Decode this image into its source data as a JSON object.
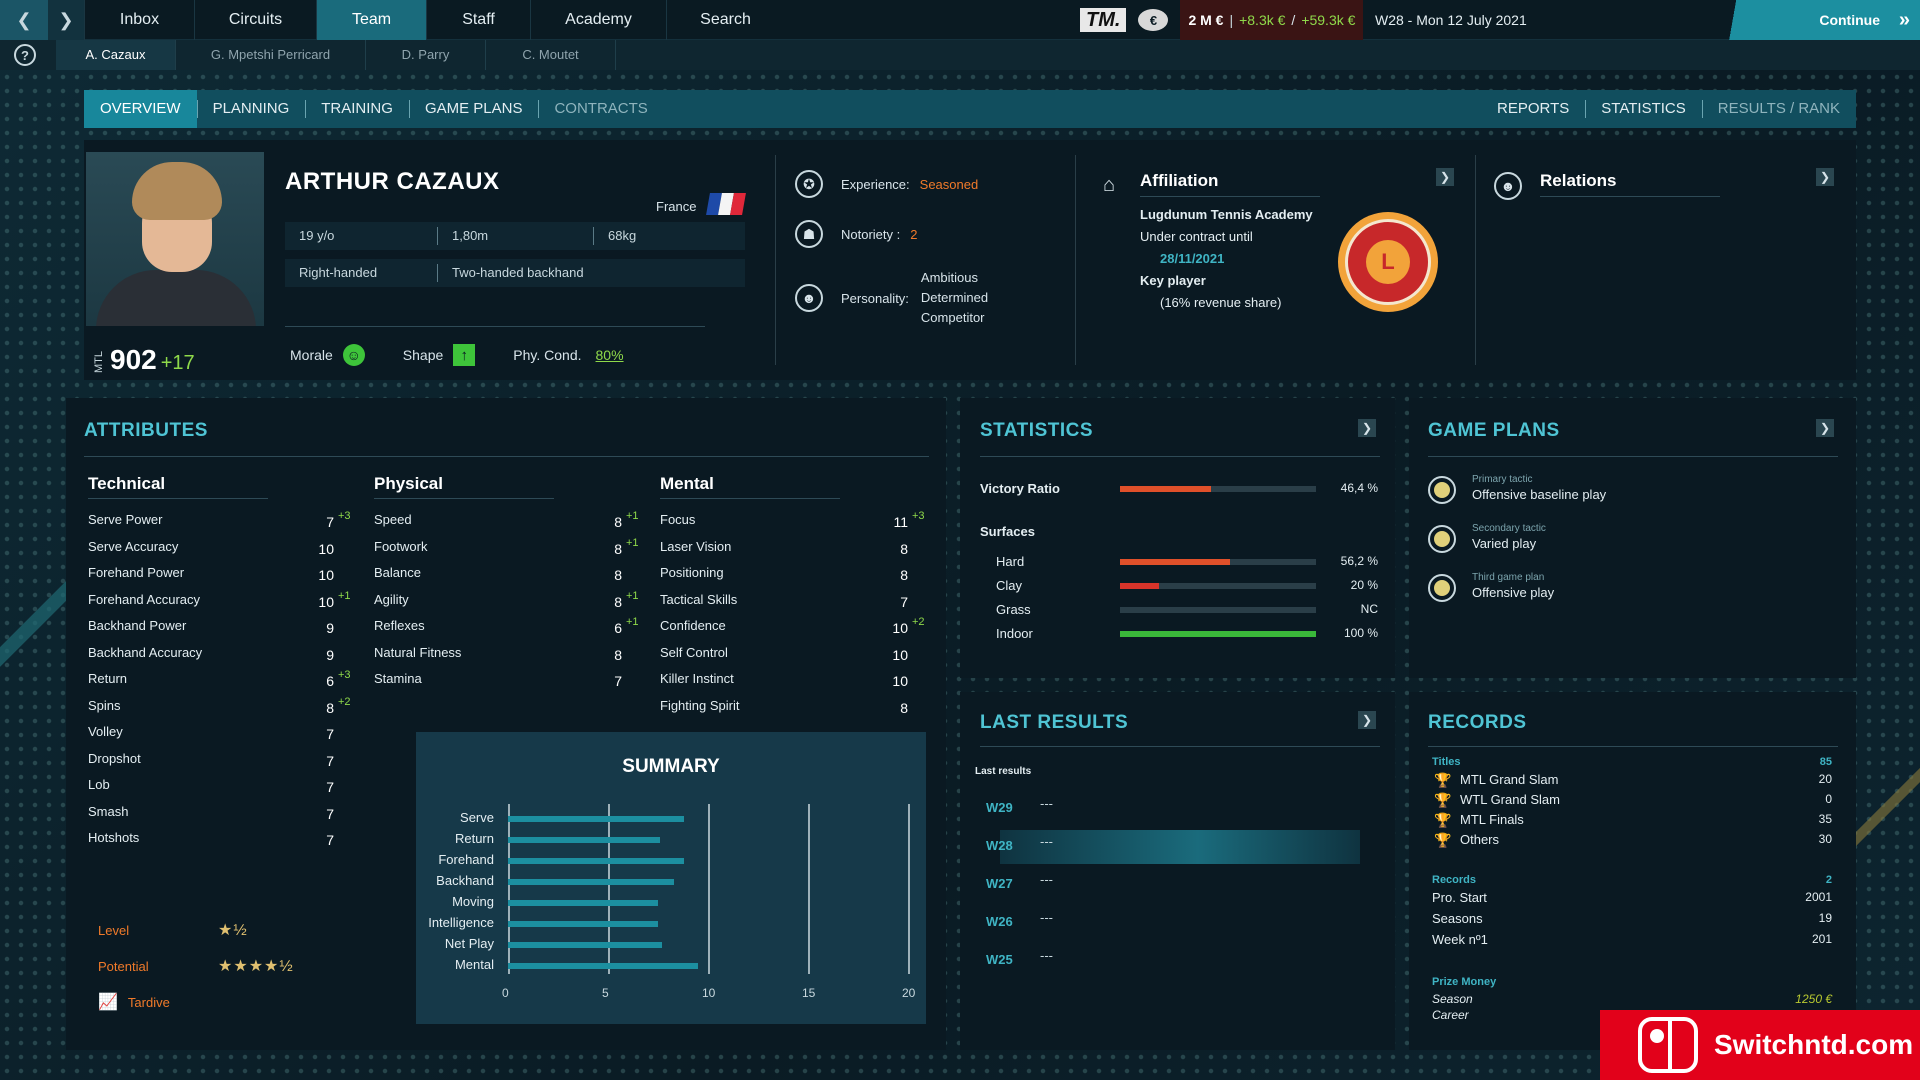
{
  "colors": {
    "accent": "#1a6b7c",
    "positive": "#8fd94a",
    "negative": "#f04a3a",
    "highlight_orange": "#f07a2a",
    "title_cyan": "#4fc4d4"
  },
  "topbar": {
    "nav": [
      "Inbox",
      "Circuits",
      "Team",
      "Staff",
      "Academy",
      "Search"
    ],
    "active_nav": "Team",
    "logo": "TM.",
    "balance": "2 M €",
    "income": "+8.3k €",
    "separator": "/",
    "extra_income": "+59.3k €",
    "date": "W28 - Mon 12 July 2021",
    "continue_label": "Continue"
  },
  "players": [
    "A. Cazaux",
    "G. Mpetshi Perricard",
    "D. Parry",
    "C. Moutet"
  ],
  "tabs_left": [
    "OVERVIEW",
    "PLANNING",
    "TRAINING",
    "GAME PLANS",
    "CONTRACTS"
  ],
  "tabs_right": [
    "REPORTS",
    "STATISTICS",
    "RESULTS / RANK"
  ],
  "player": {
    "name": "ARTHUR CAZAUX",
    "country": "France",
    "age": "19 y/o",
    "height": "1,80m",
    "weight": "68kg",
    "hand": "Right-handed",
    "backhand": "Two-handed backhand",
    "mtl_label": "MTL",
    "mtl": "902",
    "mtl_delta": "+17",
    "morale_label": "Morale",
    "shape_label": "Shape",
    "phy_label": "Phy. Cond.",
    "phy_value": "80%"
  },
  "traits": {
    "experience_label": "Experience:",
    "experience_value": "Seasoned",
    "notoriety_label": "Notoriety :",
    "notoriety_value": "2",
    "personality_label": "Personality:",
    "personality": [
      "Ambitious",
      "Determined",
      "Competitor"
    ]
  },
  "affiliation": {
    "title": "Affiliation",
    "academy": "Lugdunum Tennis Academy",
    "contract_label": "Under contract until",
    "contract_date": "28/11/2021",
    "role": "Key player",
    "share": "(16% revenue share)",
    "logo_text": "L"
  },
  "relations": {
    "title": "Relations"
  },
  "attributes": {
    "title": "ATTRIBUTES",
    "technical_title": "Technical",
    "physical_title": "Physical",
    "mental_title": "Mental",
    "technical": [
      {
        "name": "Serve Power",
        "value": "7",
        "bonus": "+3"
      },
      {
        "name": "Serve Accuracy",
        "value": "10",
        "bonus": ""
      },
      {
        "name": "Forehand Power",
        "value": "10",
        "bonus": ""
      },
      {
        "name": "Forehand Accuracy",
        "value": "10",
        "bonus": "+1"
      },
      {
        "name": "Backhand Power",
        "value": "9",
        "bonus": ""
      },
      {
        "name": "Backhand Accuracy",
        "value": "9",
        "bonus": ""
      },
      {
        "name": "Return",
        "value": "6",
        "bonus": "+3"
      },
      {
        "name": "Spins",
        "value": "8",
        "bonus": "+2"
      },
      {
        "name": "Volley",
        "value": "7",
        "bonus": ""
      },
      {
        "name": "Dropshot",
        "value": "7",
        "bonus": ""
      },
      {
        "name": "Lob",
        "value": "7",
        "bonus": ""
      },
      {
        "name": "Smash",
        "value": "7",
        "bonus": ""
      },
      {
        "name": "Hotshots",
        "value": "7",
        "bonus": ""
      }
    ],
    "physical": [
      {
        "name": "Speed",
        "value": "8",
        "bonus": "+1"
      },
      {
        "name": "Footwork",
        "value": "8",
        "bonus": "+1"
      },
      {
        "name": "Balance",
        "value": "8",
        "bonus": ""
      },
      {
        "name": "Agility",
        "value": "8",
        "bonus": "+1"
      },
      {
        "name": "Reflexes",
        "value": "6",
        "bonus": "+1"
      },
      {
        "name": "Natural Fitness",
        "value": "8",
        "bonus": ""
      },
      {
        "name": "Stamina",
        "value": "7",
        "bonus": ""
      }
    ],
    "mental": [
      {
        "name": "Focus",
        "value": "11",
        "bonus": "+3"
      },
      {
        "name": "Laser Vision",
        "value": "8",
        "bonus": ""
      },
      {
        "name": "Positioning",
        "value": "8",
        "bonus": ""
      },
      {
        "name": "Tactical Skills",
        "value": "7",
        "bonus": ""
      },
      {
        "name": "Confidence",
        "value": "10",
        "bonus": "+2"
      },
      {
        "name": "Self Control",
        "value": "10",
        "bonus": ""
      },
      {
        "name": "Killer Instinct",
        "value": "10",
        "bonus": ""
      },
      {
        "name": "Fighting Spirit",
        "value": "8",
        "bonus": ""
      }
    ],
    "level_label": "Level",
    "level_stars": "★½",
    "potential_label": "Potential",
    "potential_stars": "★★★★½",
    "tardive_label": "Tardive"
  },
  "summary": {
    "title": "SUMMARY",
    "ticks": [
      "0",
      "5",
      "10",
      "15",
      "20"
    ]
  },
  "chart_data": {
    "type": "bar",
    "categories": [
      "Serve",
      "Return",
      "Forehand",
      "Backhand",
      "Moving",
      "Intelligence",
      "Net Play",
      "Mental"
    ],
    "values": [
      8.8,
      7.6,
      8.8,
      8.3,
      7.5,
      7.5,
      7.7,
      9.5
    ],
    "title": "SUMMARY",
    "xlim": [
      0,
      20
    ]
  },
  "statistics": {
    "title": "STATISTICS",
    "victory_label": "Victory Ratio",
    "victory_value": "46,4 %",
    "victory_ratio": 0.464,
    "surfaces_label": "Surfaces",
    "surfaces": [
      {
        "name": "Hard",
        "value": "56,2 %",
        "ratio": 0.562,
        "color": "#e0502a"
      },
      {
        "name": "Clay",
        "value": "20 %",
        "ratio": 0.2,
        "color": "#d8342a"
      },
      {
        "name": "Grass",
        "value": "NC",
        "ratio": 0,
        "color": "#2a3e48"
      },
      {
        "name": "Indoor",
        "value": "100 %",
        "ratio": 1.0,
        "color": "#3ab83a"
      }
    ]
  },
  "game_plans": {
    "title": "GAME PLANS",
    "items": [
      {
        "small": "Primary tactic",
        "main": "Offensive baseline play"
      },
      {
        "small": "Secondary tactic",
        "main": "Varied play"
      },
      {
        "small": "Third game plan",
        "main": "Offensive play"
      }
    ]
  },
  "last_results": {
    "title": "LAST RESULTS",
    "subtitle": "Last results",
    "weeks": [
      {
        "week": "W29",
        "result": "---"
      },
      {
        "week": "W28",
        "result": "---"
      },
      {
        "week": "W27",
        "result": "---"
      },
      {
        "week": "W26",
        "result": "---"
      },
      {
        "week": "W25",
        "result": "---"
      }
    ]
  },
  "records": {
    "title": "RECORDS",
    "titles_label": "Titles",
    "titles_total": "85",
    "titles": [
      {
        "name": "MTL Grand Slam",
        "value": "20"
      },
      {
        "name": "WTL Grand Slam",
        "value": "0"
      },
      {
        "name": "MTL Finals",
        "value": "35"
      },
      {
        "name": "Others",
        "value": "30"
      }
    ],
    "records_label": "Records",
    "records_total": "2",
    "records": [
      {
        "name": "Pro. Start",
        "value": "2001"
      },
      {
        "name": "Seasons",
        "value": "19"
      },
      {
        "name": "Week nº1",
        "value": "201"
      }
    ],
    "prize_label": "Prize Money",
    "season_label": "Season",
    "season_value": "1250 €",
    "career_label": "Career"
  },
  "watermark": "Switchntd.com"
}
